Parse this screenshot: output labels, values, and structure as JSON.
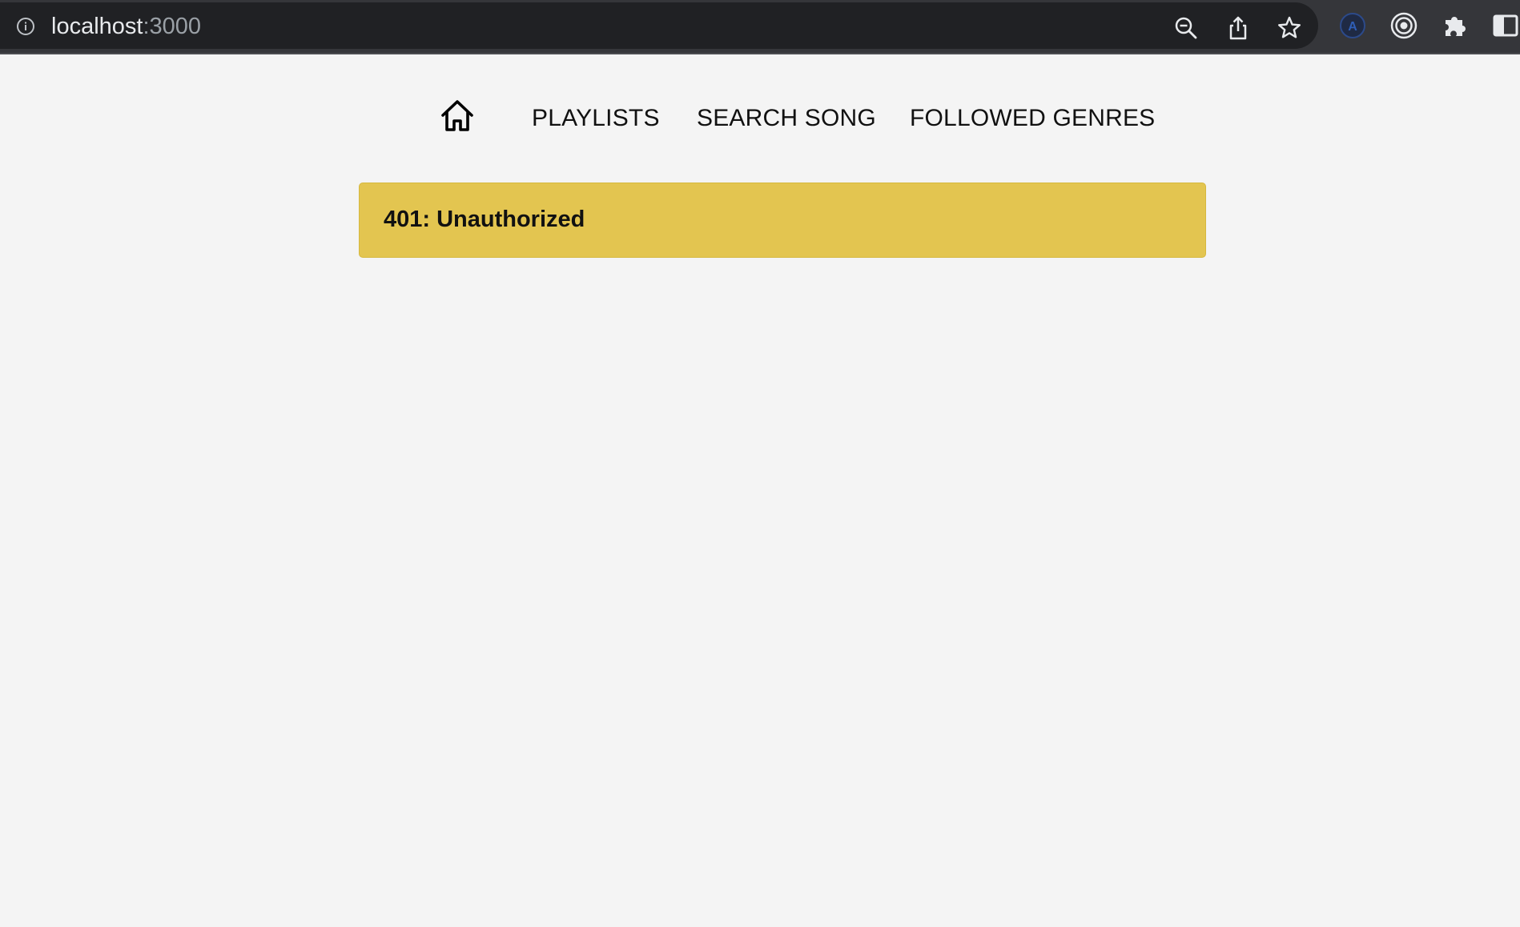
{
  "browser": {
    "url_host": "localhost",
    "url_port": ":3000",
    "icons": [
      "info-icon",
      "zoom-out-icon",
      "share-icon",
      "bookmark-star-icon",
      "extension-a-icon",
      "extension-target-icon",
      "extensions-puzzle-icon",
      "side-panel-icon"
    ]
  },
  "nav": {
    "home_icon": "home-icon",
    "links": [
      "PLAYLISTS",
      "SEARCH SONG",
      "FOLLOWED GENRES"
    ]
  },
  "alert": {
    "message": "401: Unauthorized",
    "color": "#e3c550"
  }
}
